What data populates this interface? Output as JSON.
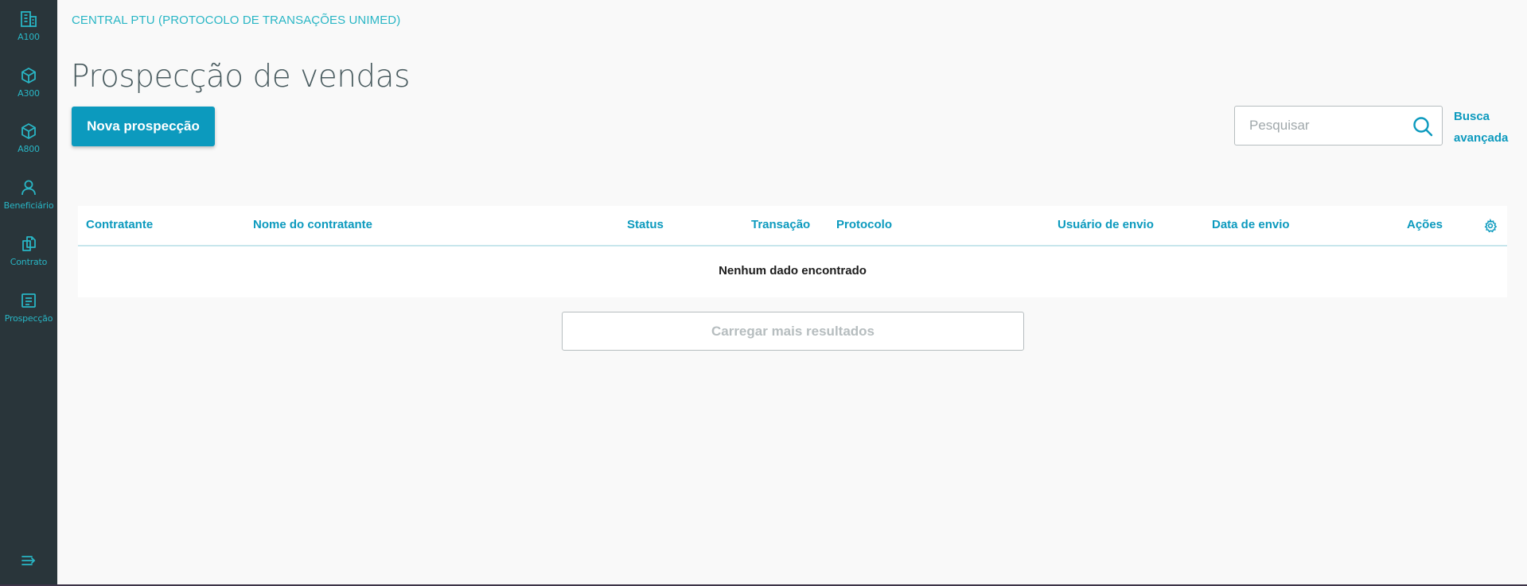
{
  "sidebar": {
    "items": [
      {
        "label": "A100",
        "icon": "building-icon"
      },
      {
        "label": "A300",
        "icon": "cube-icon"
      },
      {
        "label": "A800",
        "icon": "cube-icon"
      },
      {
        "label": "Beneficiário",
        "icon": "user-icon"
      },
      {
        "label": "Contrato",
        "icon": "documents-icon"
      },
      {
        "label": "Prospecção",
        "icon": "receipt-icon"
      }
    ],
    "toggle_icon": "collapse-menu-icon"
  },
  "header": {
    "breadcrumb": "CENTRAL PTU (PROTOCOLO DE TRANSAÇÕES UNIMED)",
    "title": "Prospecção de vendas"
  },
  "actions": {
    "new_button": "Nova prospecção",
    "search_placeholder": "Pesquisar",
    "advanced_search_line1": "Busca",
    "advanced_search_line2": "avançada"
  },
  "table": {
    "columns": [
      "Contratante",
      "Nome do contratante",
      "Status",
      "Transação",
      "Protocolo",
      "Usuário de envio",
      "Data de envio",
      "Ações"
    ],
    "empty_message": "Nenhum dado encontrado"
  },
  "load_more": "Carregar mais resultados",
  "colors": {
    "sidebar_bg": "#29353a",
    "accent": "#0c9abe",
    "accent_light": "#29b6c5",
    "title": "#4a5c60"
  }
}
